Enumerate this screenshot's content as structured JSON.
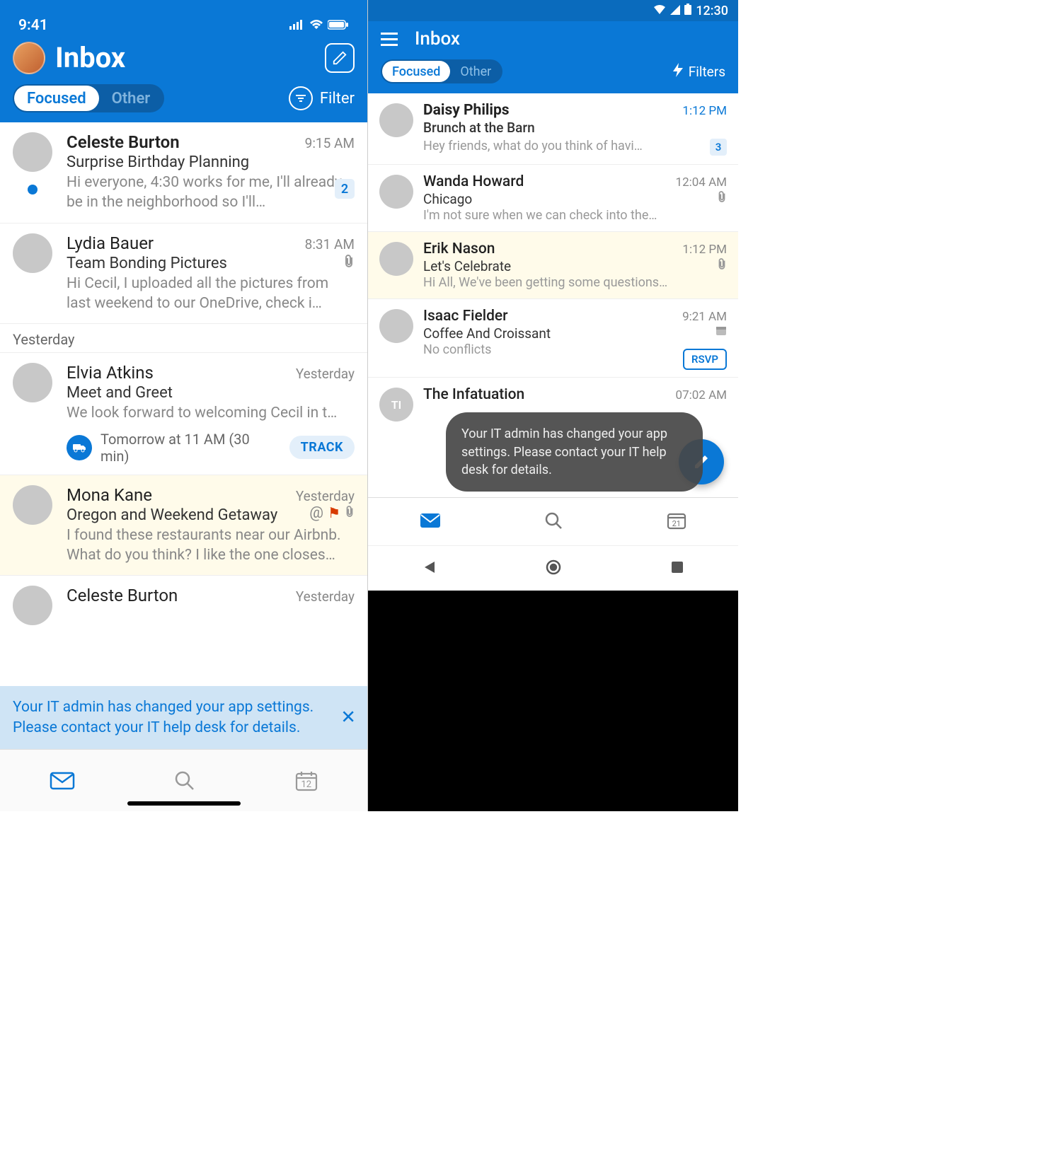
{
  "ios": {
    "status_time": "9:41",
    "title": "Inbox",
    "tab_focused": "Focused",
    "tab_other": "Other",
    "filter_label": "Filter",
    "section_yesterday": "Yesterday",
    "messages": [
      {
        "sender": "Celeste Burton",
        "time": "9:15 AM",
        "subject": "Surprise Birthday Planning",
        "preview": "Hi everyone, 4:30 works for me, I'll already be in the neighborhood so I'll…",
        "count": "2"
      },
      {
        "sender": "Lydia Bauer",
        "time": "8:31 AM",
        "subject": "Team Bonding Pictures",
        "preview": "Hi Cecil, I uploaded all the pictures from last weekend to our OneDrive, check i…"
      },
      {
        "sender": "Elvia Atkins",
        "time": "Yesterday",
        "subject": "Meet and Greet",
        "preview": "We look forward to welcoming Cecil in t…",
        "track_time": "Tomorrow at 11 AM (30 min)",
        "track_btn": "TRACK"
      },
      {
        "sender": "Mona Kane",
        "time": "Yesterday",
        "subject": "Oregon and Weekend Getaway",
        "preview": "I found these restaurants near our Airbnb. What do you think? I like the one closes…"
      },
      {
        "sender": "Celeste Burton",
        "time": "Yesterday"
      }
    ],
    "banner": "Your IT admin has changed your app settings. Please contact your IT help desk for details.",
    "calendar_day": "12"
  },
  "android": {
    "status_time": "12:30",
    "title": "Inbox",
    "tab_focused": "Focused",
    "tab_other": "Other",
    "filters_label": "Filters",
    "messages": [
      {
        "sender": "Daisy Philips",
        "time": "1:12 PM",
        "subject": "Brunch at the Barn",
        "preview": "Hey friends, what do you think of havi…",
        "count": "3"
      },
      {
        "sender": "Wanda Howard",
        "time": "12:04 AM",
        "subject": "Chicago",
        "preview": "I'm not sure when we can check into the…"
      },
      {
        "sender": "Erik Nason",
        "time": "1:12 PM",
        "subject": "Let's Celebrate",
        "preview": "Hi All, We've been getting some questions…"
      },
      {
        "sender": "Isaac Fielder",
        "time": "9:21 AM",
        "subject": "Coffee And Croissant",
        "preview": "No conflicts",
        "rsvp": "RSVP"
      },
      {
        "sender": "The Infatuation",
        "time": "07:02 AM",
        "initials": "TI"
      }
    ],
    "toast": "Your IT admin has changed your app settings. Please contact your IT help desk for details.",
    "calendar_day": "21"
  }
}
